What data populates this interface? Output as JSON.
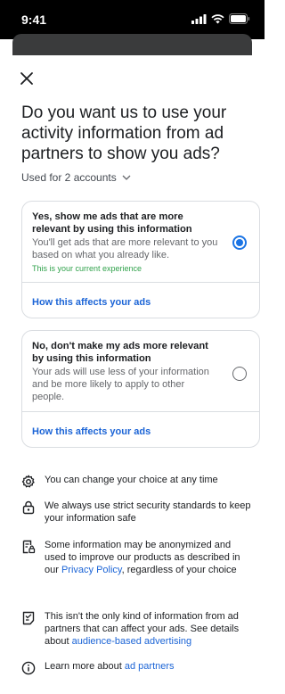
{
  "status_bar": {
    "time": "9:41",
    "icons": [
      "signal-icon",
      "wifi-icon",
      "battery-icon"
    ]
  },
  "sheet": {
    "close_icon": "close-icon",
    "title": "Do you want us to use your activity information from ad partners to show you ads?",
    "accounts_label": "Used for 2 accounts",
    "accounts_icon": "chevron-down-icon"
  },
  "options": [
    {
      "title": "Yes, show me ads that are more relevant by using this information",
      "description": "You'll get ads that are more relevant to you based on what you already like.",
      "note": "This is your current experience",
      "link": "How this affects your ads",
      "selected": true
    },
    {
      "title": "No, don't make my ads more relevant by using this information",
      "description": "Your ads will use less of your information and be more likely to apply to other people.",
      "link": "How this affects your ads",
      "selected": false
    }
  ],
  "info": {
    "change_choice": "You can change your choice at any time",
    "security": "We always use strict security standards to keep your information safe",
    "anonymized_before": "Some information may be anonymized and used to improve our products as described in our ",
    "privacy_policy_link": "Privacy Policy",
    "anonymized_after": ", regardless of your choice",
    "other_info_before": "This isn't the only kind of information from ad partners that can affect your ads. See details about ",
    "audience_link": "audience-based advertising",
    "learn_more_before": "Learn more about ",
    "ad_partners_link": "ad partners"
  },
  "colors": {
    "accent": "#1b74e4",
    "link": "#1b64d6",
    "success": "#31a24c",
    "border": "#dadde1"
  }
}
